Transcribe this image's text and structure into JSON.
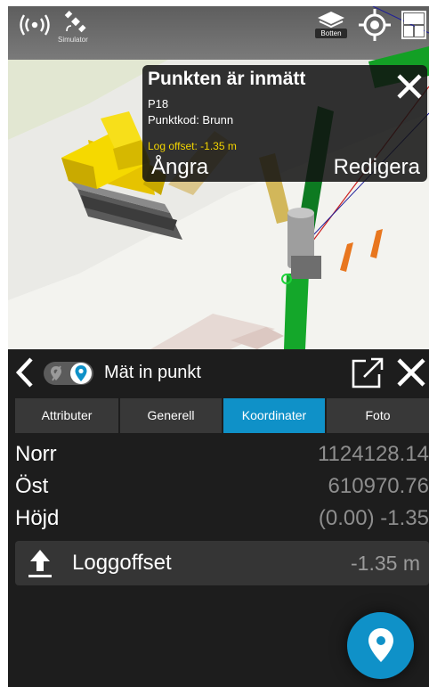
{
  "toolbar": {
    "simulator_label": "Simulator",
    "layers_label": "Botten",
    "icons": [
      "gnss-signal-icon",
      "satellite-icon",
      "layers-icon",
      "location-target-icon",
      "layout-icon"
    ]
  },
  "popup": {
    "title": "Punkten är inmätt",
    "point_name": "P18",
    "point_code": "Punktkod: Brunn",
    "log_offset": "Log offset: -1.35 m",
    "undo_label": "Ångra",
    "edit_label": "Redigera",
    "offset_color": "#f2d400"
  },
  "panel": {
    "title": "Mät in punkt",
    "tabs": [
      {
        "label": "Attributer",
        "active": false
      },
      {
        "label": "Generell",
        "active": false
      },
      {
        "label": "Koordinater",
        "active": true
      },
      {
        "label": "Foto",
        "active": false
      }
    ],
    "coordinates": [
      {
        "label": "Norr",
        "value": "1124128.14"
      },
      {
        "label": "Öst",
        "value": "610970.76"
      },
      {
        "label": "Höjd",
        "value": "(0.00) -1.35"
      }
    ],
    "log_offset": {
      "label": "Loggoffset",
      "value": "-1.35 m"
    },
    "accent_color": "#0f91c8"
  }
}
